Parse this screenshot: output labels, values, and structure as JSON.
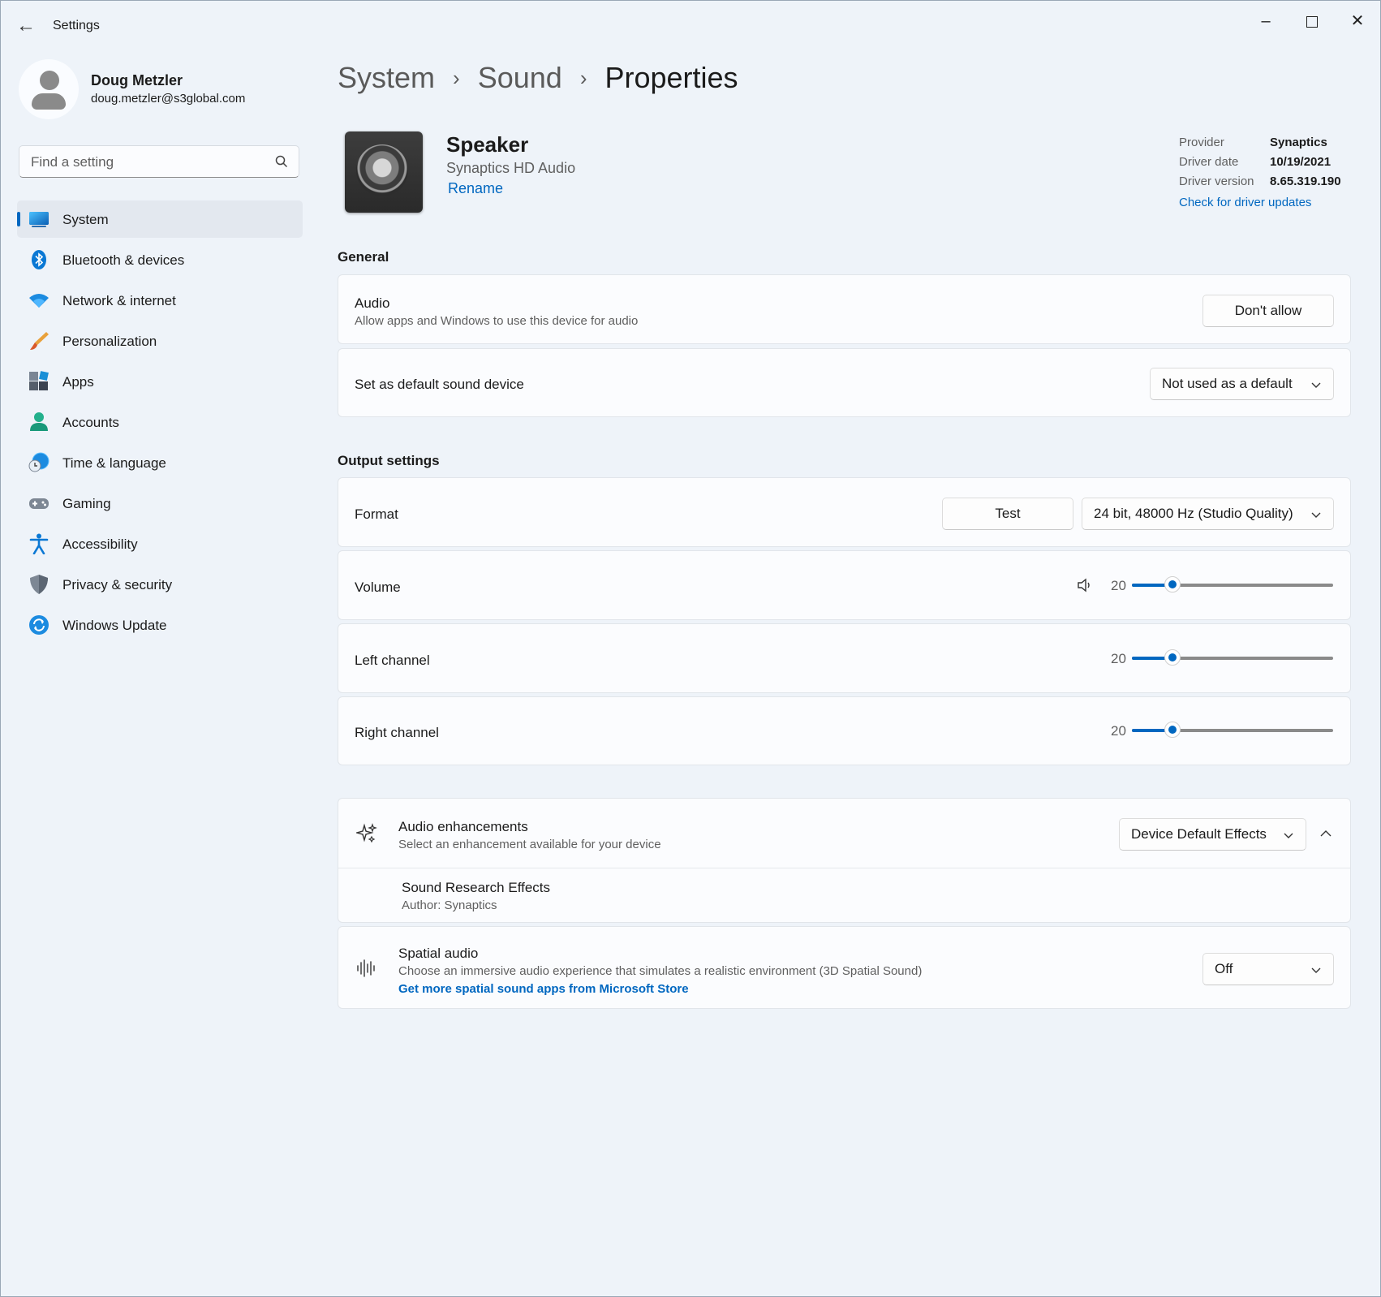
{
  "app": {
    "title": "Settings"
  },
  "user": {
    "name": "Doug Metzler",
    "email": "doug.metzler@s3global.com"
  },
  "search": {
    "placeholder": "Find a setting"
  },
  "sidebar": {
    "items": [
      {
        "label": "System",
        "icon": "system-icon",
        "active": true
      },
      {
        "label": "Bluetooth & devices",
        "icon": "bluetooth-icon"
      },
      {
        "label": "Network & internet",
        "icon": "wifi-icon"
      },
      {
        "label": "Personalization",
        "icon": "brush-icon"
      },
      {
        "label": "Apps",
        "icon": "apps-icon"
      },
      {
        "label": "Accounts",
        "icon": "accounts-icon"
      },
      {
        "label": "Time & language",
        "icon": "globe-clock-icon"
      },
      {
        "label": "Gaming",
        "icon": "gamepad-icon"
      },
      {
        "label": "Accessibility",
        "icon": "accessibility-icon"
      },
      {
        "label": "Privacy & security",
        "icon": "shield-icon"
      },
      {
        "label": "Windows Update",
        "icon": "update-icon"
      }
    ]
  },
  "breadcrumb": {
    "level1": "System",
    "level2": "Sound",
    "current": "Properties",
    "separator": "›"
  },
  "device": {
    "name": "Speaker",
    "subtitle": "Synaptics HD Audio",
    "rename": "Rename",
    "driver": [
      {
        "key": "Provider",
        "value": "Synaptics"
      },
      {
        "key": "Driver date",
        "value": "10/19/2021"
      },
      {
        "key": "Driver version",
        "value": "8.65.319.190"
      }
    ],
    "driver_link": "Check for driver updates"
  },
  "general": {
    "title": "General",
    "audio": {
      "title": "Audio",
      "desc": "Allow apps and Windows to use this device for audio",
      "button": "Don't allow"
    },
    "default_device": {
      "title": "Set as default sound device",
      "selected": "Not used as a default"
    }
  },
  "output": {
    "title": "Output settings",
    "format": {
      "title": "Format",
      "test": "Test",
      "selected": "24 bit, 48000 Hz (Studio Quality)"
    },
    "volume": {
      "title": "Volume",
      "value": "20",
      "level": 0.2
    },
    "left": {
      "title": "Left channel",
      "value": "20",
      "level": 0.2
    },
    "right": {
      "title": "Right channel",
      "value": "20",
      "level": 0.2
    }
  },
  "enhancements": {
    "title": "Audio enhancements",
    "desc": "Select an enhancement available for your device",
    "selected": "Device Default Effects",
    "effect": {
      "name": "Sound Research Effects",
      "author": "Author: Synaptics"
    }
  },
  "spatial": {
    "title": "Spatial audio",
    "desc": "Choose an immersive audio experience that simulates a realistic environment (3D Spatial Sound)",
    "link": "Get more spatial sound apps from Microsoft Store",
    "selected": "Off"
  },
  "colors": {
    "accent": "#0067c0",
    "background": "#eef3f9",
    "card": "#fbfcfe"
  }
}
